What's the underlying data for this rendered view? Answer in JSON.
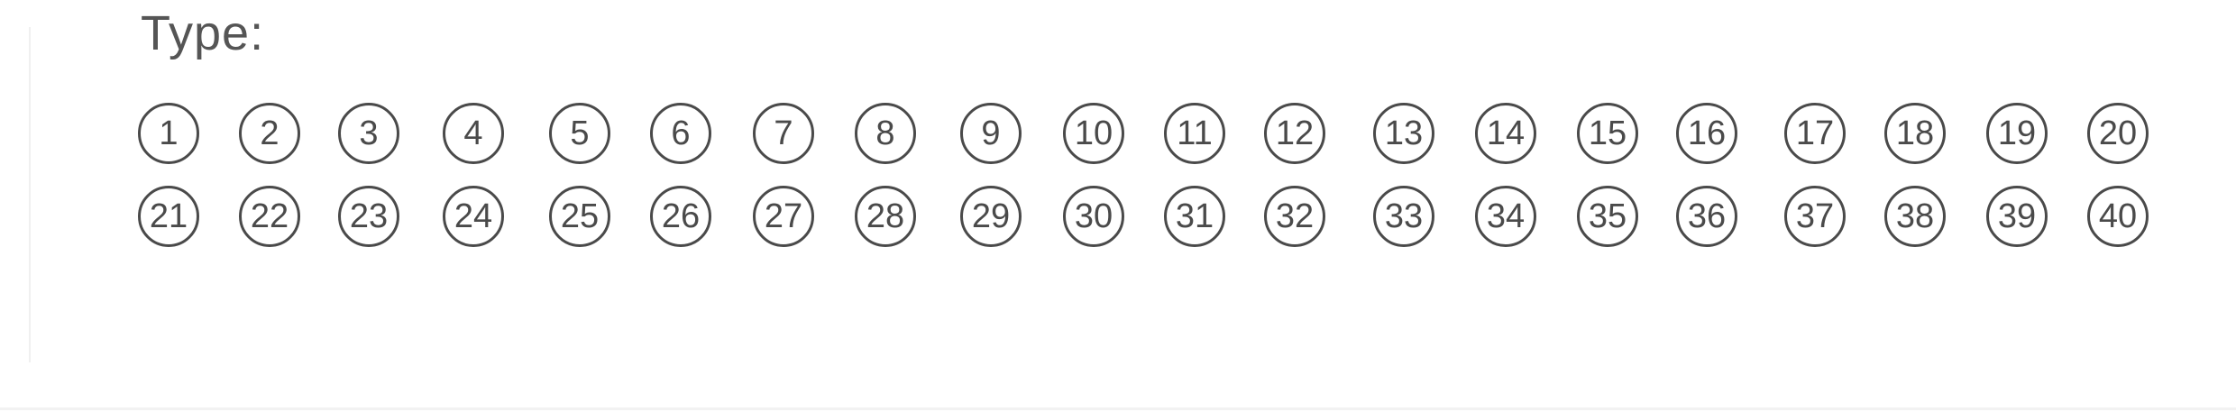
{
  "form": {
    "type_label": "Type:",
    "options": [
      "1",
      "2",
      "3",
      "4",
      "5",
      "6",
      "7",
      "8",
      "9",
      "10",
      "11",
      "12",
      "13",
      "14",
      "15",
      "16",
      "17",
      "18",
      "19",
      "20",
      "21",
      "22",
      "23",
      "24",
      "25",
      "26",
      "27",
      "28",
      "29",
      "30",
      "31",
      "32",
      "33",
      "34",
      "35",
      "36",
      "37",
      "38",
      "39",
      "40"
    ]
  }
}
